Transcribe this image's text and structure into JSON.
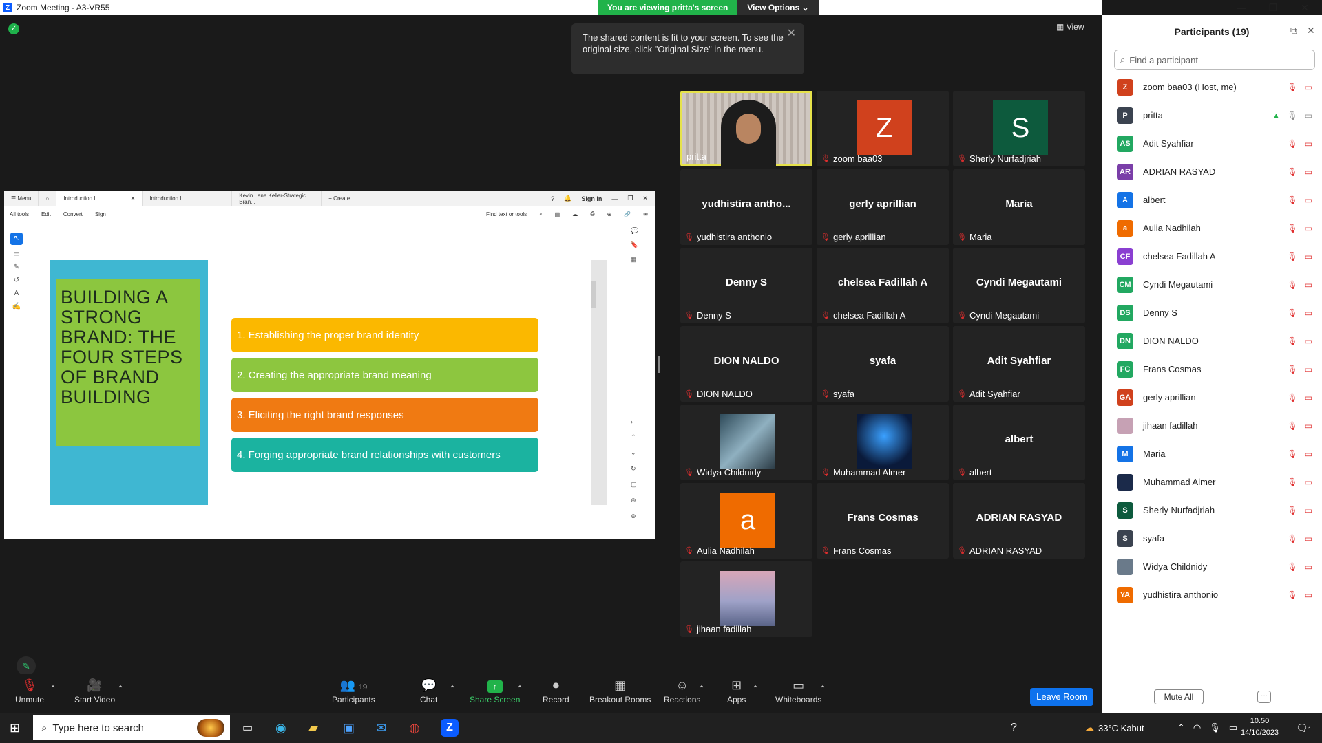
{
  "window": {
    "title": "Zoom Meeting - A3-VR55",
    "logo": "Z",
    "min": "—",
    "max": "❐",
    "close": "✕"
  },
  "banner": {
    "viewing": "You are viewing pritta's screen",
    "options": "View Options",
    "chevron": "⌄"
  },
  "view_label": "View",
  "toast": {
    "text": "The shared content is fit to your screen. To see the original size, click \"Original Size\" in the menu.",
    "close": "✕"
  },
  "acrobat": {
    "tabs": [
      "Introduction I",
      "Introduction I",
      "Kevin Lane Keller-Strategic Bran...",
      "Create"
    ],
    "menu_label": "Menu",
    "sign_in": "Sign in",
    "menu": [
      "All tools",
      "Edit",
      "Convert",
      "Sign"
    ],
    "find": "Find text or tools"
  },
  "slide": {
    "title": "BUILDING A STRONG BRAND: THE FOUR STEPS OF BRAND BUILDING",
    "steps": [
      {
        "text": "1. Establishing the proper brand identity",
        "color": "#fbb800"
      },
      {
        "text": "2. Creating the appropriate brand meaning",
        "color": "#8dc63f"
      },
      {
        "text": "3. Eliciting the right brand responses",
        "color": "#f07a12"
      },
      {
        "text": "4. Forging appropriate brand relationships with customers",
        "color": "#1bb3a0"
      }
    ]
  },
  "gallery": [
    {
      "name": "pritta",
      "display": "video"
    },
    {
      "name": "zoom baa03",
      "avatar": "Z",
      "color": "#d0411d"
    },
    {
      "name": "Sherly Nurfadjriah",
      "avatar": "S",
      "color": "#0d5a3d"
    },
    {
      "name": "yudhistira anthonio",
      "big": "yudhistira antho..."
    },
    {
      "name": "gerly aprillian",
      "big": "gerly aprillian"
    },
    {
      "name": "Maria",
      "big": "Maria"
    },
    {
      "name": "Denny S",
      "big": "Denny S"
    },
    {
      "name": "chelsea Fadillah A",
      "big": "chelsea Fadillah A"
    },
    {
      "name": "Cyndi Megautami",
      "big": "Cyndi Megautami"
    },
    {
      "name": "DION NALDO",
      "big": "DION NALDO"
    },
    {
      "name": "syafa",
      "big": "syafa"
    },
    {
      "name": "Adit Syahfiar",
      "big": "Adit Syahfiar"
    },
    {
      "name": "Widya Childnidy",
      "display": "photo"
    },
    {
      "name": "Muhammad Almer",
      "display": "photo2"
    },
    {
      "name": "albert",
      "big": "albert"
    },
    {
      "name": "Aulia Nadhilah",
      "avatar": "a",
      "color": "#ef6b00"
    },
    {
      "name": "Frans Cosmas",
      "big": "Frans Cosmas"
    },
    {
      "name": "ADRIAN RASYAD",
      "big": "ADRIAN RASYAD"
    },
    {
      "name": "jihaan fadillah",
      "display": "sky"
    }
  ],
  "toolbar": {
    "unmute": "Unmute",
    "start_video": "Start Video",
    "participants": "Participants",
    "participants_count": "19",
    "chat": "Chat",
    "share": "Share Screen",
    "record": "Record",
    "breakout": "Breakout Rooms",
    "reactions": "Reactions",
    "apps": "Apps",
    "whiteboards": "Whiteboards",
    "leave": "Leave Room"
  },
  "panel": {
    "title": "Participants (19)",
    "search_placeholder": "Find a participant",
    "mute_all": "Mute All",
    "more": "···",
    "people": [
      {
        "initials": "Z",
        "name": "zoom baa03 (Host, me)",
        "color": "#d0411d"
      },
      {
        "initials": "P",
        "name": "pritta",
        "color": "#3b4350"
      },
      {
        "initials": "AS",
        "name": "Adit Syahfiar",
        "color": "#22a861"
      },
      {
        "initials": "AR",
        "name": "ADRIAN RASYAD",
        "color": "#7a3ea8"
      },
      {
        "initials": "A",
        "name": "albert",
        "color": "#1473e6"
      },
      {
        "initials": "a",
        "name": "Aulia Nadhilah",
        "color": "#ef6b00"
      },
      {
        "initials": "CF",
        "name": "chelsea Fadillah A",
        "color": "#8a3fd1"
      },
      {
        "initials": "CM",
        "name": "Cyndi Megautami",
        "color": "#22a861"
      },
      {
        "initials": "DS",
        "name": "Denny S",
        "color": "#22a861"
      },
      {
        "initials": "DN",
        "name": "DION NALDO",
        "color": "#22a861"
      },
      {
        "initials": "FC",
        "name": "Frans Cosmas",
        "color": "#22a861"
      },
      {
        "initials": "GA",
        "name": "gerly aprillian",
        "color": "#d0411d"
      },
      {
        "initials": "",
        "name": "jihaan fadillah",
        "color": "#c6a1b4"
      },
      {
        "initials": "M",
        "name": "Maria",
        "color": "#1473e6"
      },
      {
        "initials": "",
        "name": "Muhammad Almer",
        "color": "#1b2a4a"
      },
      {
        "initials": "S",
        "name": "Sherly Nurfadjriah",
        "color": "#0d5a3d"
      },
      {
        "initials": "S",
        "name": "syafa",
        "color": "#3b4350"
      },
      {
        "initials": "",
        "name": "Widya Childnidy",
        "color": "#6a7a8a"
      },
      {
        "initials": "YA",
        "name": "yudhistira anthonio",
        "color": "#ef6b00"
      }
    ]
  },
  "taskbar": {
    "search": "Type here to search",
    "weather": "33°C Kabut",
    "time": "10.50",
    "date": "14/10/2023",
    "notif": "1"
  }
}
